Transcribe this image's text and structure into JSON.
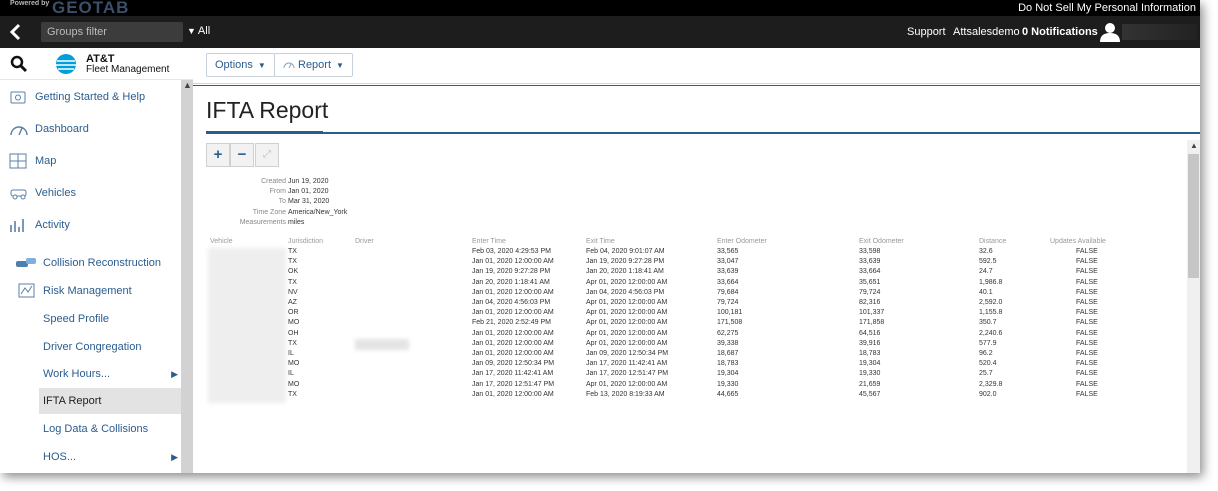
{
  "topbar": {
    "powered_by": "Powered by",
    "brand": "GEOTAB",
    "do_not_sell": "Do Not Sell My Personal Information"
  },
  "header": {
    "groups_placeholder": "Groups filter",
    "all_label": "All",
    "support": "Support",
    "account": "Attsalesdemo",
    "notifications": "0 Notifications"
  },
  "sidebar": {
    "logo_line1": "AT&T",
    "logo_line2": "Fleet Management",
    "items": [
      {
        "label": "Getting Started & Help",
        "icon": "help-icon"
      },
      {
        "label": "Dashboard",
        "icon": "gauge-icon"
      },
      {
        "label": "Map",
        "icon": "map-icon"
      },
      {
        "label": "Vehicles",
        "icon": "vehicle-icon"
      },
      {
        "label": "Activity",
        "icon": "activity-icon"
      },
      {
        "label": "Collision Reconstruction",
        "icon": "collision-icon"
      },
      {
        "label": "Risk Management",
        "icon": "risk-icon"
      }
    ],
    "subitems": [
      {
        "label": "Speed Profile"
      },
      {
        "label": "Driver Congregation"
      },
      {
        "label": "Work Hours..."
      },
      {
        "label": "IFTA Report"
      },
      {
        "label": "Log Data & Collisions"
      },
      {
        "label": "HOS..."
      }
    ]
  },
  "toolbar": {
    "options_label": "Options",
    "report_label": "Report"
  },
  "page": {
    "title": "IFTA Report"
  },
  "meta": [
    {
      "key": "Created",
      "value": "Jun 19, 2020"
    },
    {
      "key": "From",
      "value": "Jan 01, 2020"
    },
    {
      "key": "To",
      "value": "Mar 31, 2020"
    },
    {
      "key": "Time Zone",
      "value": "America/New_York"
    },
    {
      "key": "Measurements",
      "value": "miles"
    }
  ],
  "table": {
    "headers": [
      "Vehicle",
      "Jurisdiction",
      "Driver",
      "Enter Time",
      "Exit Time",
      "Enter Odometer",
      "Exit Odometer",
      "Distance",
      "Updates Available"
    ],
    "rows": [
      [
        "TX",
        "Feb 03, 2020 4:29:53 PM",
        "Feb 04, 2020 9:01:07 AM",
        "33,565",
        "33,598",
        "32.6",
        "FALSE"
      ],
      [
        "TX",
        "Jan 01, 2020 12:00:00 AM",
        "Jan 19, 2020 9:27:28 PM",
        "33,047",
        "33,639",
        "592.5",
        "FALSE"
      ],
      [
        "OK",
        "Jan 19, 2020 9:27:28 PM",
        "Jan 20, 2020 1:18:41 AM",
        "33,639",
        "33,664",
        "24.7",
        "FALSE"
      ],
      [
        "TX",
        "Jan 20, 2020 1:18:41 AM",
        "Apr 01, 2020 12:00:00 AM",
        "33,664",
        "35,651",
        "1,986.8",
        "FALSE"
      ],
      [
        "NV",
        "Jan 01, 2020 12:00:00 AM",
        "Jan 04, 2020 4:56:03 PM",
        "79,684",
        "79,724",
        "40.1",
        "FALSE"
      ],
      [
        "AZ",
        "Jan 04, 2020 4:56:03 PM",
        "Apr 01, 2020 12:00:00 AM",
        "79,724",
        "82,316",
        "2,592.0",
        "FALSE"
      ],
      [
        "OR",
        "Jan 01, 2020 12:00:00 AM",
        "Apr 01, 2020 12:00:00 AM",
        "100,181",
        "101,337",
        "1,155.8",
        "FALSE"
      ],
      [
        "MO",
        "Feb 21, 2020 2:52:49 PM",
        "Apr 01, 2020 12:00:00 AM",
        "171,508",
        "171,858",
        "350.7",
        "FALSE"
      ],
      [
        "OH",
        "Jan 01, 2020 12:00:00 AM",
        "Apr 01, 2020 12:00:00 AM",
        "62,275",
        "64,516",
        "2,240.6",
        "FALSE"
      ],
      [
        "TX",
        "Jan 01, 2020 12:00:00 AM",
        "Apr 01, 2020 12:00:00 AM",
        "39,338",
        "39,916",
        "577.9",
        "FALSE"
      ],
      [
        "IL",
        "Jan 01, 2020 12:00:00 AM",
        "Jan 09, 2020 12:50:34 PM",
        "18,687",
        "18,783",
        "96.2",
        "FALSE"
      ],
      [
        "MO",
        "Jan 09, 2020 12:50:34 PM",
        "Jan 17, 2020 11:42:41 AM",
        "18,783",
        "19,304",
        "520.4",
        "FALSE"
      ],
      [
        "IL",
        "Jan 17, 2020 11:42:41 AM",
        "Jan 17, 2020 12:51:47 PM",
        "19,304",
        "19,330",
        "25.7",
        "FALSE"
      ],
      [
        "MO",
        "Jan 17, 2020 12:51:47 PM",
        "Apr 01, 2020 12:00:00 AM",
        "19,330",
        "21,659",
        "2,329.8",
        "FALSE"
      ],
      [
        "TX",
        "Jan 01, 2020 12:00:00 AM",
        "Feb 13, 2020 8:19:33 AM",
        "44,665",
        "45,567",
        "902.0",
        "FALSE"
      ]
    ]
  }
}
